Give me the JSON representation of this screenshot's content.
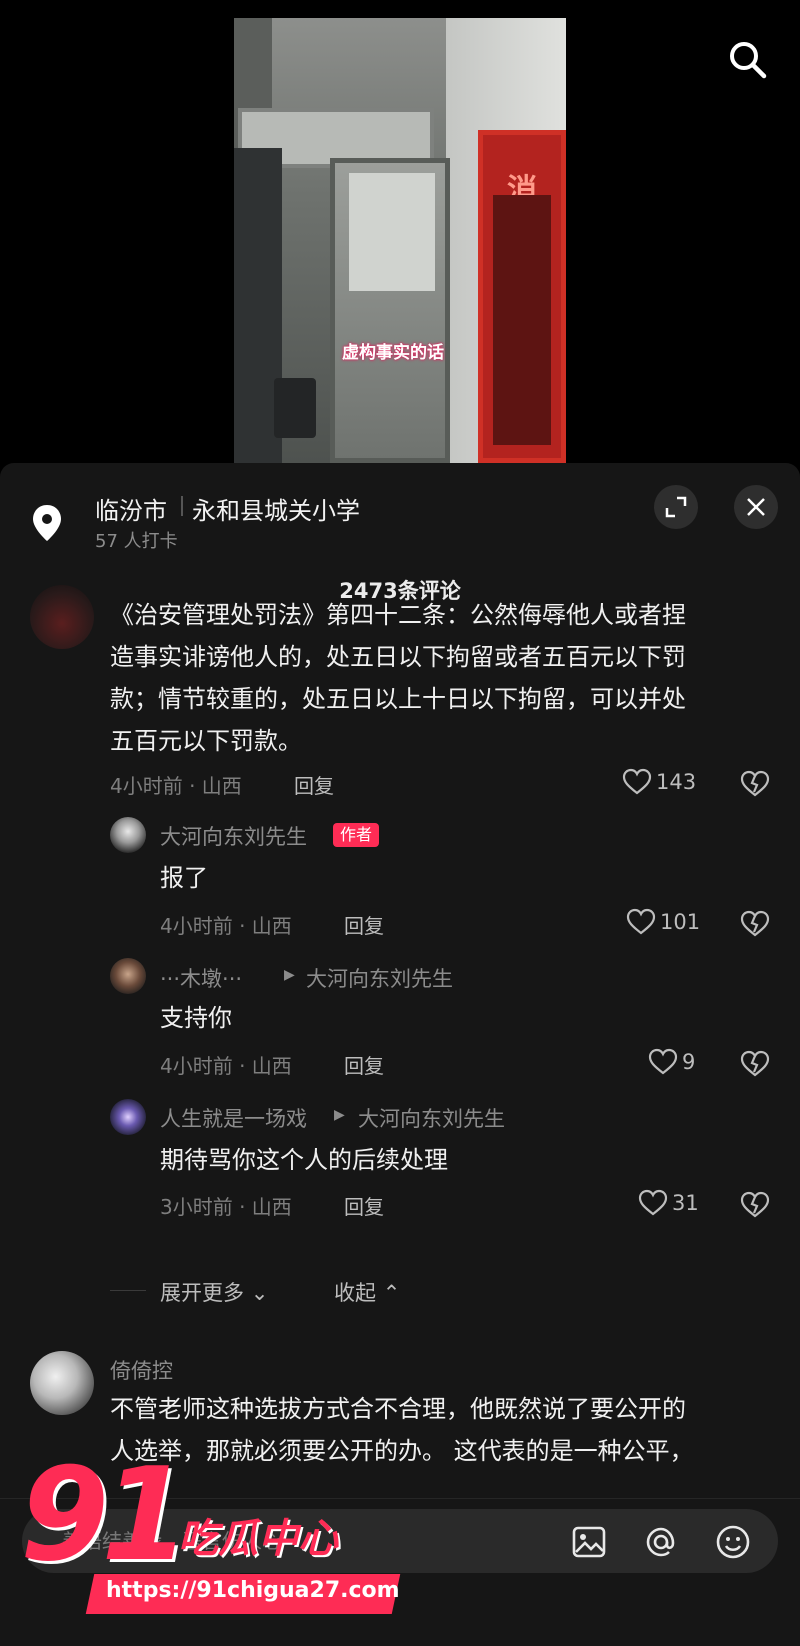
{
  "video": {
    "subtitle": "虚构事实的话",
    "fire_box_char": "消"
  },
  "location": {
    "city": "临汾市",
    "place": "永和县城关小学",
    "checkins": "57 人打卡"
  },
  "comments_header": {
    "count": "2473条评论"
  },
  "comments": [
    {
      "text_lines": [
        "《治安管理处罚法》第四十二条：公然侮辱他人或者捏",
        "造事实诽谤他人的，处五日以下拘留或者五百元以下罚",
        "款；情节较重的，处五日以上十日以下拘留，可以并处",
        "五百元以下罚款。"
      ],
      "meta": "4小时前 · 山西",
      "reply": "回复",
      "likes": "143"
    },
    {
      "user": "大河向东刘先生",
      "tag": "作者",
      "text": "报了",
      "meta": "4小时前 · 山西",
      "reply": "回复",
      "likes": "101"
    },
    {
      "user": "···木墩···",
      "reply_to": "大河向东刘先生",
      "text": "支持你",
      "meta": "4小时前 · 山西",
      "reply": "回复",
      "likes": "9"
    },
    {
      "user": "人生就是一场戏",
      "reply_to": "大河向东刘先生",
      "text": "期待骂你这个人的后续处理",
      "meta": "3小时前 · 山西",
      "reply": "回复",
      "likes": "31"
    },
    {
      "user": "倚倚控",
      "text_lines": [
        "不管老师这种选拔方式合不合理，他既然说了要公开的",
        "人选举，那就必须要公开的办。 这代表的是一种公平，"
      ]
    }
  ],
  "thread_controls": {
    "expand_more": "展开更多",
    "collapse": "收起"
  },
  "input": {
    "placeholder": "善语结善缘，恶言伤人心"
  },
  "watermark": {
    "number": "91",
    "name": "吃瓜中心",
    "url": "https://91chigua27.com"
  },
  "colors": {
    "accent": "#fe2c55",
    "sheet_bg": "#161616",
    "text": "#f0f0f0",
    "muted": "#7e7e7e"
  },
  "icons": [
    "search-icon",
    "location-pin-icon",
    "expand-icon",
    "close-icon",
    "heart-icon",
    "broken-heart-icon",
    "image-icon",
    "at-icon",
    "emoji-icon"
  ]
}
